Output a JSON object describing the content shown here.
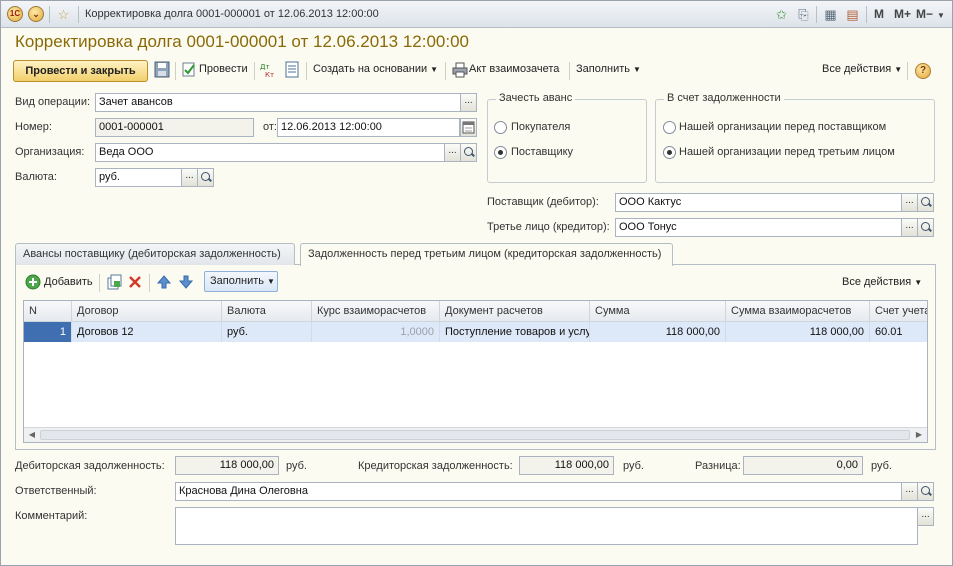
{
  "window": {
    "title": "Корректировка долга 0001-000001 от 12.06.2013 12:00:00",
    "m_buttons": [
      "M",
      "M+",
      "M−"
    ]
  },
  "document": {
    "heading": "Корректировка долга 0001-000001 от 12.06.2013 12:00:00"
  },
  "toolbar": {
    "post_close": "Провести и закрыть",
    "post": "Провести",
    "create_based": "Создать на основании",
    "act": "Акт взаимозачета",
    "fill": "Заполнить",
    "all_actions": "Все действия",
    "help": "?"
  },
  "form": {
    "op_type_label": "Вид операции:",
    "op_type_value": "Зачет авансов",
    "number_label": "Номер:",
    "number_value": "0001-000001",
    "date_label": "от:",
    "date_value": "12.06.2013 12:00:00",
    "org_label": "Организация:",
    "org_value": "Веда ООО",
    "currency_label": "Валюта:",
    "currency_value": "руб.",
    "supplier_label": "Поставщик (дебитор):",
    "supplier_value": "ООО Кактус",
    "third_label": "Третье лицо (кредитор):",
    "third_value": "ООО Тонус"
  },
  "advance_group": {
    "title": "Зачесть аванс",
    "options": [
      "Покупателя",
      "Поставщику"
    ],
    "selected": 1
  },
  "debt_group": {
    "title": "В счет задолженности",
    "options": [
      "Нашей организации перед поставщиком",
      "Нашей организации перед третьим лицом"
    ],
    "selected": 1
  },
  "tabs": [
    {
      "label": "Авансы поставщику (дебиторская задолженность)",
      "active": false
    },
    {
      "label": "Задолженность перед третьим лицом (кредиторская задолженность)",
      "active": true
    }
  ],
  "table_toolbar": {
    "add": "Добавить",
    "fill": "Заполнить",
    "all_actions": "Все действия"
  },
  "table": {
    "columns": [
      "N",
      "Договор",
      "Валюта",
      "Курс взаиморасчетов",
      "Документ расчетов",
      "Сумма",
      "Сумма взаиморасчетов",
      "Счет учета"
    ],
    "rows": [
      [
        "1",
        "Договов 12",
        "руб.",
        "1,0000",
        "Поступление товаров и услуг",
        "118 000,00",
        "118 000,00",
        "60.01"
      ]
    ]
  },
  "totals": {
    "debit_label": "Дебиторская задолженность:",
    "debit_value": "118 000,00",
    "debit_unit": "руб.",
    "credit_label": "Кредиторская задолженность:",
    "credit_value": "118 000,00",
    "credit_unit": "руб.",
    "diff_label": "Разница:",
    "diff_value": "0,00",
    "diff_unit": "руб."
  },
  "footer": {
    "responsible_label": "Ответственный:",
    "responsible_value": "Краснова Дина Олеговна",
    "comment_label": "Комментарий:",
    "comment_value": ""
  },
  "colors": {
    "title_color": "#8a6a06",
    "selected_row": "#dde9f8",
    "main_button": "#f2cf6c"
  }
}
